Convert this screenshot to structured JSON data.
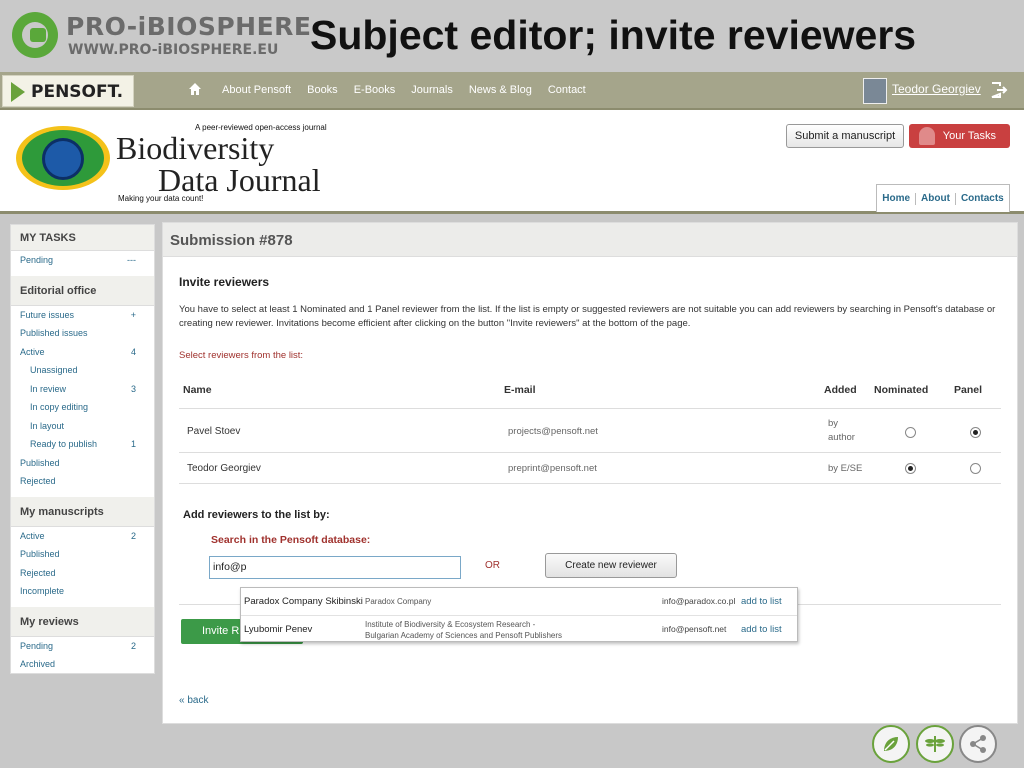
{
  "slide": {
    "logo_title": "PRO-iBIOSPHERE",
    "logo_url": "WWW.PRO-iBIOSPHERE.EU",
    "title": "Subject editor; invite reviewers"
  },
  "topnav": {
    "brand": "PENSOFT.",
    "links": [
      "About Pensoft",
      "Books",
      "E-Books",
      "Journals",
      "News & Blog",
      "Contact"
    ],
    "user_name": "Teodor Georgiev"
  },
  "journal": {
    "tagline": "A peer-reviewed open-access journal",
    "name_line1": "Biodiversity",
    "name_line2": "Data Journal",
    "motto": "Making your data count!",
    "submit_label": "Submit a manuscript",
    "tasks_label": "Your Tasks",
    "tabs": [
      "Home",
      "About",
      "Contacts"
    ]
  },
  "sidebar": {
    "my_tasks": {
      "title": "MY TASKS",
      "items": [
        {
          "label": "Pending",
          "count": "---"
        }
      ]
    },
    "editorial_office": {
      "title": "Editorial office",
      "items": [
        {
          "label": "Future issues",
          "count": "+"
        },
        {
          "label": "Published issues",
          "count": ""
        },
        {
          "label": "Active",
          "count": "4"
        },
        {
          "label": "Unassigned",
          "count": ""
        },
        {
          "label": "In review",
          "count": "3"
        },
        {
          "label": "In copy editing",
          "count": ""
        },
        {
          "label": "In layout",
          "count": ""
        },
        {
          "label": "Ready to publish",
          "count": "1"
        },
        {
          "label": "Published",
          "count": ""
        },
        {
          "label": "Rejected",
          "count": ""
        }
      ]
    },
    "my_manuscripts": {
      "title": "My manuscripts",
      "items": [
        {
          "label": "Active",
          "count": "2"
        },
        {
          "label": "Published",
          "count": ""
        },
        {
          "label": "Rejected",
          "count": ""
        },
        {
          "label": "Incomplete",
          "count": ""
        }
      ]
    },
    "my_reviews": {
      "title": "My reviews",
      "items": [
        {
          "label": "Pending",
          "count": "2"
        },
        {
          "label": "Archived",
          "count": ""
        }
      ]
    }
  },
  "main": {
    "submission_title": "Submission #878",
    "invite_title": "Invite reviewers",
    "description": "You have to select at least 1 Nominated and 1 Panel reviewer from the list. If the list is empty or suggested reviewers are not suitable you can add reviewers by searching in Pensoft's database or creating new reviewer. Invitations become efficient after clicking on the button \"Invite reviewers\" at the bottom of the page.",
    "select_label": "Select reviewers from the list:",
    "columns": [
      "Name",
      "E-mail",
      "Added",
      "Nominated",
      "Panel"
    ],
    "reviewers": [
      {
        "name": "Pavel Stoev",
        "email": "projects@pensoft.net",
        "added_line1": "by",
        "added_line2": "author",
        "nominated": false,
        "panel": true
      },
      {
        "name": "Teodor Georgiev",
        "email": "preprint@pensoft.net",
        "added_line1": "by E/SE",
        "added_line2": "",
        "nominated": true,
        "panel": false
      }
    ],
    "add_title": "Add reviewers to the list by:",
    "search_label": "Search in the Pensoft database:",
    "search_value": "info@p",
    "or_label": "OR",
    "create_label": "Create new reviewer",
    "invite_label": "Invite R",
    "back_label": "« back"
  },
  "autocomplete": [
    {
      "name": "Paradox Company Skibinski",
      "institution_line1": "Paradox Company",
      "institution_line2": "",
      "email": "info@paradox.co.pl",
      "action": "add to list"
    },
    {
      "name": "Lyubomir Penev",
      "institution_line1": "Institute of Biodiversity & Ecosystem Research -",
      "institution_line2": "Bulgarian Academy of Sciences and Pensoft Publishers",
      "email": "info@pensoft.net",
      "action": "add to list"
    }
  ],
  "colors": {
    "accent_green": "#3c9a48",
    "link_blue": "#2a6a8a",
    "label_red": "#a0322e",
    "nav_olive": "#a5a58b",
    "tasks_red": "#c94040"
  },
  "icons": [
    "home-icon",
    "logout-icon",
    "leaf-icon",
    "dragonfly-icon",
    "share-icon"
  ]
}
